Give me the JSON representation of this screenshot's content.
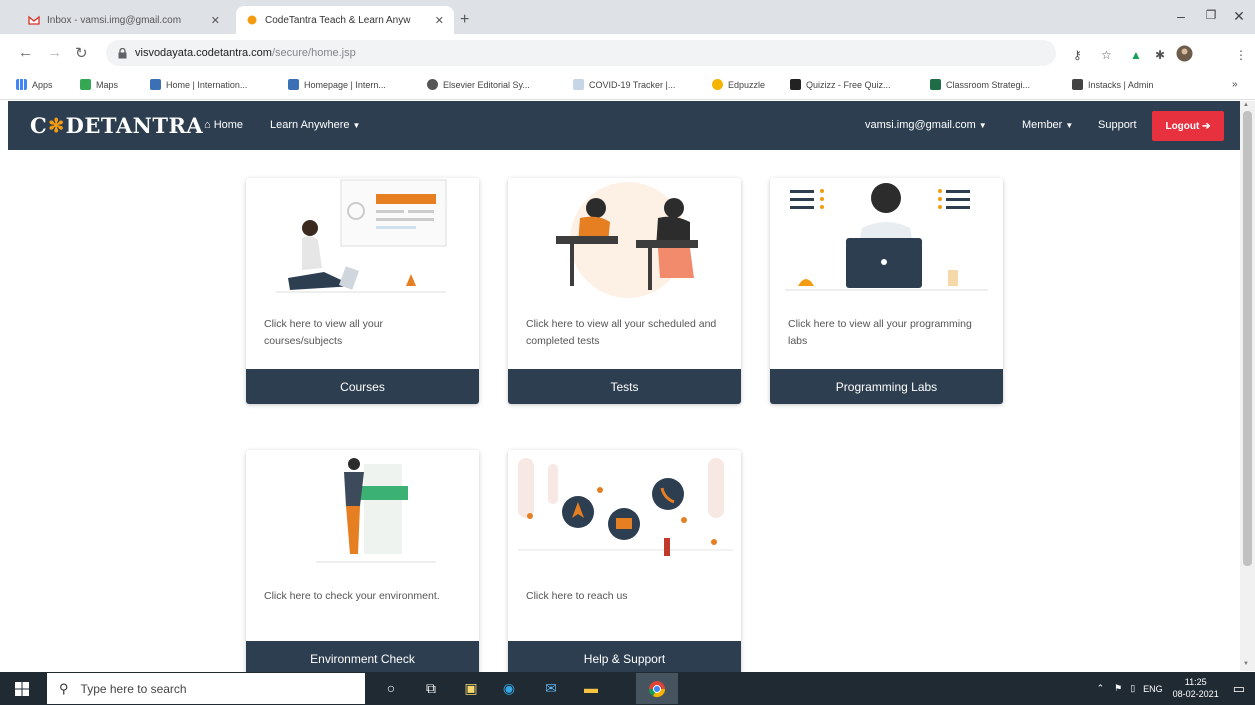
{
  "browser": {
    "tabs": [
      {
        "title": "Inbox - vamsi.img@gmail.com",
        "active": false
      },
      {
        "title": "CodeTantra Teach & Learn Anyw",
        "active": true
      }
    ],
    "url_host": "visvodayata.codetantra.com",
    "url_path": "/secure/home.jsp",
    "bookmarks": [
      "Apps",
      "Maps",
      "Home | Internation...",
      "Homepage | Intern...",
      "Elsevier Editorial Sy...",
      "COVID-19 Tracker |...",
      "Edpuzzle",
      "Quizizz - Free Quiz...",
      "Classroom Strategi...",
      "Instacks | Admin"
    ]
  },
  "site": {
    "logo_left": "C",
    "logo_right": "DETANTRA",
    "nav": {
      "home": "Home",
      "learn_anywhere": "Learn Anywhere",
      "email": "vamsi.img@gmail.com",
      "member": "Member",
      "support": "Support",
      "logout": "Logout"
    }
  },
  "cards": [
    {
      "description": "Click here to view all your courses/subjects",
      "button": "Courses",
      "illustration": "student-laptop-illustration"
    },
    {
      "description": "Click here to view all your scheduled and completed tests",
      "button": "Tests",
      "illustration": "students-writing-illustration"
    },
    {
      "description": "Click here to view all your programming labs",
      "button": "Programming Labs",
      "illustration": "programmer-laptop-illustration"
    },
    {
      "description": "Click here to check your environment.",
      "button": "Environment Check",
      "illustration": "environment-check-illustration"
    },
    {
      "description": "Click here to reach us",
      "button": "Help & Support",
      "illustration": "help-support-illustration"
    }
  ],
  "taskbar": {
    "search_placeholder": "Type here to search",
    "language": "ENG",
    "time": "11:25",
    "date": "08-02-2021"
  },
  "colors": {
    "navbar": "#2c3e50",
    "logout": "#e8313f",
    "accent_orange": "#f39c12"
  }
}
